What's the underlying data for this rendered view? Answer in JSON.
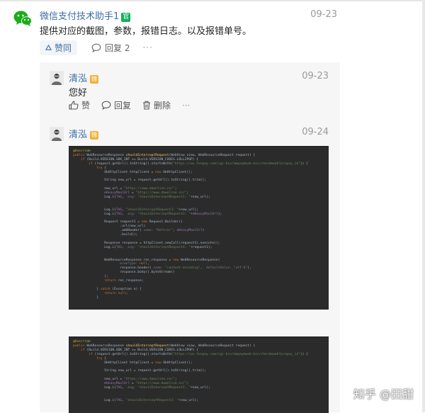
{
  "post": {
    "author": "微信支付技术助手1",
    "badge": "官",
    "date": "09-23",
    "content": "提供对应的截图，参数，报错日志。以及报错单号。",
    "like_label": "赞同",
    "reply_label": "回复 2",
    "more": "···"
  },
  "replies": [
    {
      "name": "清泓",
      "level_badge": "锦",
      "date": "09-23",
      "text": "您好",
      "actions": {
        "like": "赞",
        "reply": "回复",
        "delete": "删除",
        "more": "···"
      }
    },
    {
      "name": "清泓",
      "level_badge": "锦",
      "date": "09-24"
    }
  ],
  "code_lines": [
    "@Override",
    "public WebResourceResponse shouldInterceptRequest(WebView view, WebResourceRequest request) {",
    "    if (Build.VERSION.SDK_INT >= Build.VERSION_CODES.LOLLIPOP) {",
    "        if (request.getUrl().toString().startsWith(\"https://wx.tenpay.com/cgi-bin/mmpaymweb-bin/checkmweb?prepay_id\")) {",
    "            try {",
    "                OkHttpClient httpClient = new OkHttpClient();",
    "",
    "                String new_url = request.getUrl().toString().trim();",
    "",
    "                new_url = \"https://www.dawnline.cn/\";",
    "                mHeavyMaulUrl = \"https://www.dawnline.cn/\";",
    "                Log.i(TAG,  msg: \"shouldInterceptRequest1: \"+new_url);",
    "",
    "",
    "                Log.i(TAG, \"shouldInterceptRequest3: \"+new_url);",
    "                Log.i(TAG,  msg: \"shouldInterceptRequest2: \"+mHeavyMaulUrl);",
    "",
    "                Request request1 = new Request.Builder()",
    "                        .url(new_url)",
    "                        .addHeader( name: \"Referer\", mHeavyMaulUrl)",
    "                        .build();",
    "",
    "                Response response = httpClient.newCall(request1).execute();",
    "                Log.i(TAG,  msg: \"shouldInterceptRequest4: \"+request1);",
    "",
    "",
    "                WebResourceResponse res_response = new WebResourceResponse(",
    "                        mimeType: null,",
    "                        response.header( name: \"content-encoding\",  defaultValue: \"utf-8\"),",
    "                        response.body().byteStream()",
    "                );",
    "                return res_response;",
    "",
    "            } catch (Exception e) {",
    "                return null;",
    "            }"
  ],
  "code_lines_2": [
    "@Override",
    "public WebResourceResponse shouldInterceptRequest(WebView view, WebResourceRequest request) {",
    "    if (Build.VERSION.SDK_INT >= Build.VERSION_CODES.LOLLIPOP) {",
    "        if (request.getUrl().toString().startsWith(\"https://wx.tenpay.com/cgi-bin/mmpaymweb-bin/checkmweb?prepay_id\")) {",
    "            try {",
    "                OkHttpClient httpClient = new OkHttpClient();",
    "",
    "                String new_url = request.getUrl().toString().trim();",
    "",
    "                new_url = \"https://www.dawnline.cn/\";",
    "                mHeavyMaulUrl = \"https://www.dawnline.cn/\";",
    "                Log.i(TAG,  msg: \"shouldInterceptRequest1: \"+new_url);",
    "",
    "",
    "                Log.i(TAG, \"shouldInterceptRequest3: \"+new_url);"
  ],
  "watermark": "知乎 @田甜",
  "colors": {
    "link_blue": "#3b6ea5",
    "official_green": "#12b05a",
    "badge_gold": "#f0b23c",
    "code_bg": "#2b2b2b"
  }
}
